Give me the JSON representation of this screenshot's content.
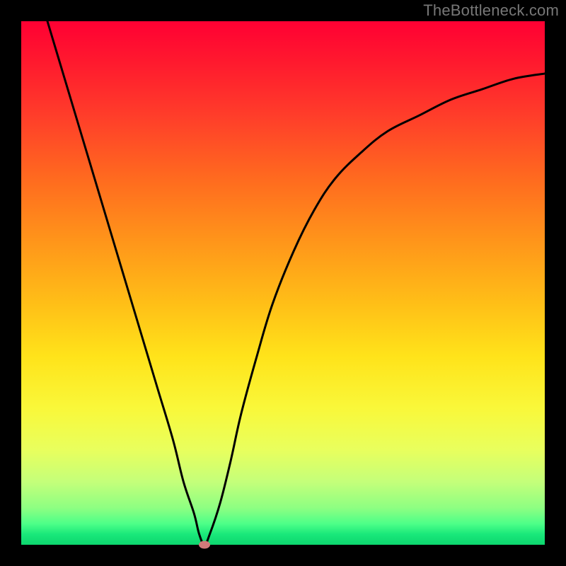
{
  "watermark": "TheBottleneck.com",
  "chart_data": {
    "type": "line",
    "title": "",
    "xlabel": "",
    "ylabel": "",
    "xlim": [
      0,
      100
    ],
    "ylim": [
      0,
      100
    ],
    "series": [
      {
        "name": "bottleneck-curve",
        "x": [
          5,
          8,
          11,
          14,
          17,
          20,
          23,
          26,
          29,
          31,
          33,
          34,
          35,
          36,
          38,
          40,
          42,
          45,
          48,
          52,
          56,
          60,
          65,
          70,
          76,
          82,
          88,
          94,
          100
        ],
        "y": [
          100,
          90,
          80,
          70,
          60,
          50,
          40,
          30,
          20,
          12,
          6,
          2,
          0,
          2,
          8,
          16,
          25,
          36,
          46,
          56,
          64,
          70,
          75,
          79,
          82,
          85,
          87,
          89,
          90
        ]
      }
    ],
    "marker": {
      "x": 35,
      "y": 0,
      "name": "optimal-point"
    },
    "grid": false,
    "legend": false,
    "background_gradient": {
      "top": "#ff0033",
      "mid": "#ffe31a",
      "bottom": "#0dd66e"
    }
  },
  "colors": {
    "curve": "#000000",
    "marker": "#d07a7a",
    "frame": "#000000"
  }
}
